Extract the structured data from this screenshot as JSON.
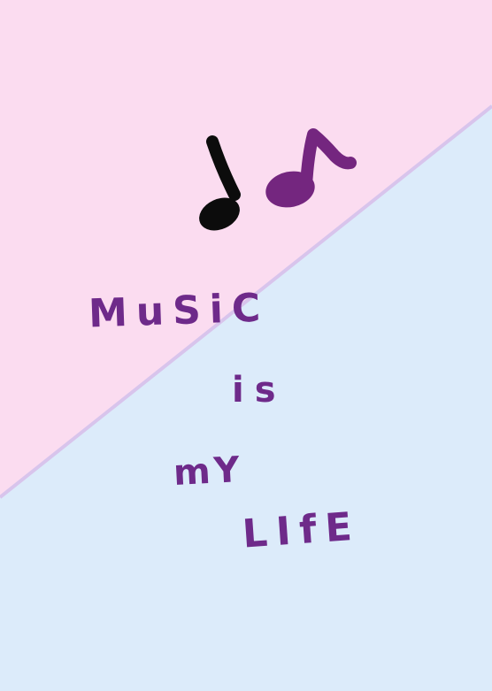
{
  "colors": {
    "top_triangle": "#fbdcf0",
    "bottom_area": "#dcebfa",
    "divider": "#d8c4ec",
    "note_black": "#0c0c0c",
    "note_purple": "#74267f",
    "text": "#6e2a8a"
  },
  "icons": [
    "quarter-note-icon",
    "eighth-note-icon"
  ],
  "lines": [
    "MuSiC",
    "is",
    "mY",
    "LIfE"
  ]
}
